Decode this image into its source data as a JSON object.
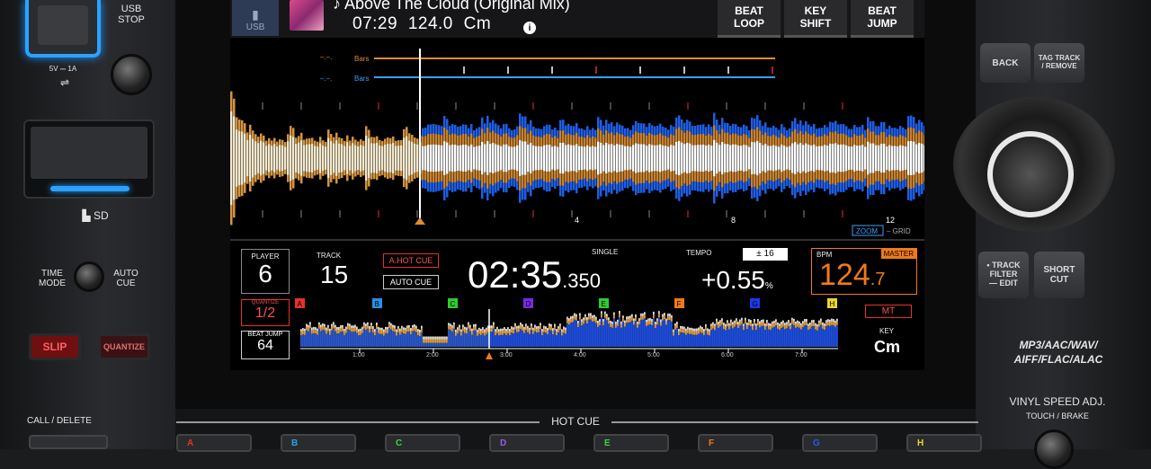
{
  "left": {
    "usb_stop": "USB\nSTOP",
    "usb_spec": "5V ⎓ 1A",
    "sd": "SD",
    "time_mode": "TIME\nMODE",
    "auto_cue": "AUTO\nCUE",
    "slip": "SLIP",
    "quantize": "QUANTIZE",
    "call_delete": "CALL / DELETE"
  },
  "header": {
    "source": "USB",
    "title": "♪ Above The Cloud (Original Mix)",
    "time": "07:29",
    "bpm": "124.0",
    "key": "Cm",
    "info": "i",
    "buttons": [
      "BEAT\nLOOP",
      "KEY\nSHIFT",
      "BEAT\nJUMP"
    ]
  },
  "wave": {
    "bars_label_1": "Bars",
    "bars_label_2": "Bars",
    "beat_numbers": [
      "4",
      "8",
      "12"
    ],
    "zoom": "ZOOM",
    "grid": "– GRID"
  },
  "status": {
    "player_label": "PLAYER",
    "player": "6",
    "track_label": "TRACK",
    "track": "15",
    "a_hot_cue": "A.HOT CUE",
    "auto_cue": "AUTO CUE",
    "mode": "SINGLE",
    "time_main": "02:35",
    "time_ms": ".350",
    "tempo_label": "TEMPO",
    "tempo_range": "± 16",
    "tempo": "+0.55",
    "tempo_unit": "%",
    "bpm_label": "BPM",
    "master": "MASTER",
    "bpm_int": "124",
    "bpm_dec": ".7",
    "mt": "MT",
    "key_label": "KEY",
    "key": "Cm",
    "quantize_label": "QUANTIZE",
    "quantize": "1/2",
    "beat_jump_label": "BEAT JUMP",
    "beat_jump": "64",
    "cue_letters": [
      "A",
      "B",
      "C",
      "D",
      "E",
      "F",
      "G",
      "H"
    ],
    "cue_colors": [
      "#e8302a",
      "#2a8fe8",
      "#2ecc2e",
      "#7a2ae8",
      "#2ecc2e",
      "#f07a1a",
      "#1a3ae8",
      "#e8d82a"
    ],
    "time_ticks": [
      "1:00",
      "2:00",
      "3:00",
      "4:00",
      "5:00",
      "6:00",
      "7:00"
    ]
  },
  "right": {
    "back": "BACK",
    "tag_track": "TAG TRACK\n/ REMOVE",
    "track_filter": "• TRACK\nFILTER\n— EDIT",
    "short_cut": "SHORT\nCUT",
    "formats": "MP3/AAC/WAV/\nAIFF/FLAC/ALAC",
    "vinyl_speed": "VINYL SPEED ADJ.",
    "touch_brake": "TOUCH / BRAKE"
  },
  "bottom": {
    "hot_cue": "HOT CUE",
    "pads": [
      "A",
      "B",
      "C",
      "D",
      "E",
      "F",
      "G",
      "H"
    ],
    "pad_colors": [
      "#e8302a",
      "#2aa0e8",
      "#3cd63c",
      "#9a5ae8",
      "#3cd63c",
      "#f07a1a",
      "#2a5ae8",
      "#e8d82a"
    ]
  }
}
